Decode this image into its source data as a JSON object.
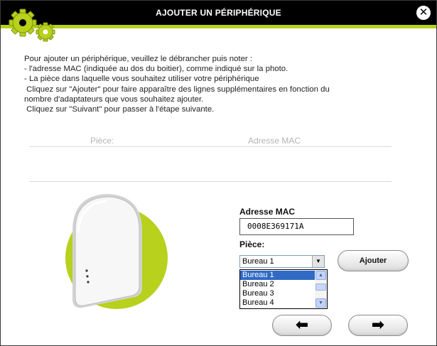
{
  "window": {
    "title": "AJOUTER UN PÉRIPHÉRIQUE",
    "close_symbol": "✕"
  },
  "colors": {
    "titlebar": "#000000",
    "accent": "#b7d11c",
    "selection": "#316ac5"
  },
  "icons": [
    "gears-icon",
    "close-icon",
    "chevron-down-icon",
    "scroll-up-icon",
    "scroll-down-icon",
    "arrow-left-icon",
    "arrow-right-icon"
  ],
  "instructions": [
    "Pour ajouter un périphérique, veuillez le débrancher puis noter :",
    "- l'adresse MAC (indiquée au dos du boitier), comme indiqué sur la photo.",
    "- La pièce dans laquelle vous souhaitez utiliser votre périphérique",
    " Cliquez sur \"Ajouter\" pour faire apparaître des lignes supplémentaires en fonction du",
    "nombre d'adaptateurs que vous souhaitez ajouter.",
    " Cliquez sur \"Suivant\" pour passer à l'étape suivante."
  ],
  "table": {
    "col_piece": "Pièce:",
    "col_mac": "Adresse MAC"
  },
  "form": {
    "mac_label": "Adresse MAC",
    "mac_value": "0008E369171A",
    "piece_label": "Pièce:",
    "piece_selected": "Bureau 1",
    "piece_options": [
      "Bureau 1",
      "Bureau 2",
      "Bureau 3",
      "Bureau 4"
    ],
    "add_label": "Ajouter"
  },
  "nav": {
    "prev_symbol": "⬅",
    "next_symbol": "➡"
  }
}
